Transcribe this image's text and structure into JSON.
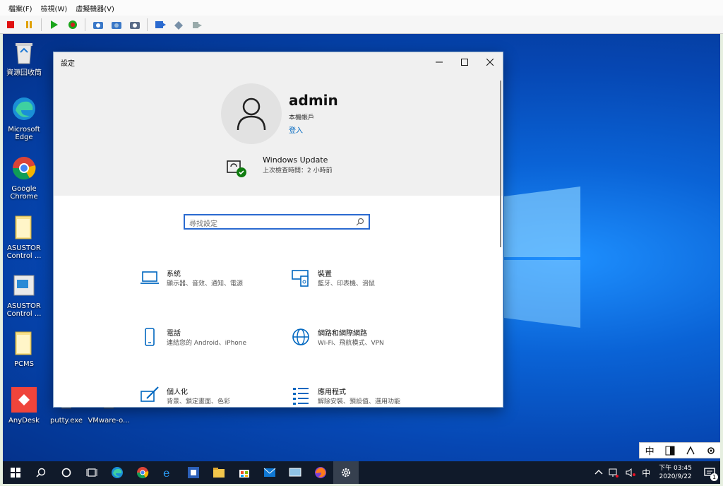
{
  "host": {
    "menu": [
      "檔案(F)",
      "檢視(W)",
      "虛擬機器(V)"
    ]
  },
  "desktop": {
    "icons": [
      {
        "label": "資源回收筒",
        "icon": "recycle-bin-icon"
      },
      {
        "label": "Microsoft Edge",
        "icon": "edge-icon"
      },
      {
        "label": "Google Chrome",
        "icon": "chrome-icon"
      },
      {
        "label": "ASUSTOR Control ...",
        "icon": "folder-icon"
      },
      {
        "label": "ASUSTOR Control ...",
        "icon": "control-app-icon"
      },
      {
        "label": "PCMS",
        "icon": "folder-icon"
      },
      {
        "label": "AnyDesk",
        "icon": "anydesk-icon"
      },
      {
        "label": "putty.exe",
        "icon": "putty-icon"
      },
      {
        "label": "VMware-o...",
        "icon": "vmware-icon"
      }
    ]
  },
  "settings": {
    "window_title": "設定",
    "user": {
      "name": "admin",
      "type": "本機帳戶",
      "login_link": "登入"
    },
    "update": {
      "title": "Windows Update",
      "subtitle": "上次檢查時間：2 小時前"
    },
    "search": {
      "placeholder": "尋找設定"
    },
    "categories": [
      {
        "name": "系統",
        "desc": "顯示器、音效、通知、電源",
        "icon": "laptop-icon"
      },
      {
        "name": "裝置",
        "desc": "藍牙、印表機、滑鼠",
        "icon": "devices-icon"
      },
      {
        "name": "電話",
        "desc": "連結您的 Android、iPhone",
        "icon": "phone-icon"
      },
      {
        "name": "網路和網際網路",
        "desc": "Wi-Fi、飛航模式、VPN",
        "icon": "globe-icon"
      },
      {
        "name": "個人化",
        "desc": "背景、鎖定畫面、色彩",
        "icon": "personalization-icon"
      },
      {
        "name": "應用程式",
        "desc": "解除安裝、預設值、選用功能",
        "icon": "apps-list-icon"
      }
    ]
  },
  "taskbar": {
    "ime": "中",
    "time": "下午 03:45",
    "date": "2020/9/22",
    "notification_count": "1"
  },
  "ime_bar": {
    "mode": "中"
  },
  "colors": {
    "accent": "#0067c0",
    "taskbar": "#101a2a",
    "desktop": "#0a63d6"
  }
}
